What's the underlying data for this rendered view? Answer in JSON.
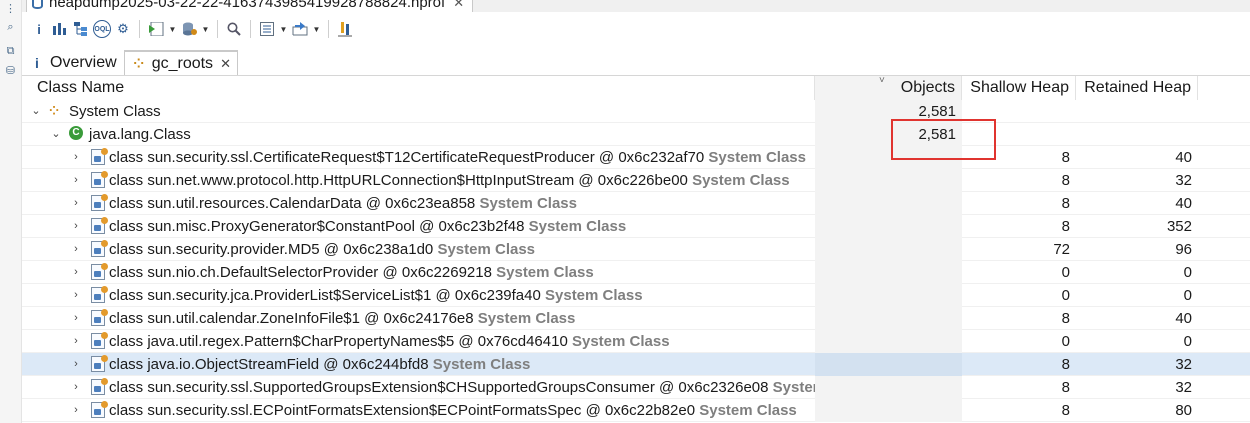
{
  "editor_tab": {
    "title": "heapdump2025-03-22-22-4163743985419928788824.hprof"
  },
  "toolbar": {
    "icons": [
      "info-icon",
      "histogram-icon",
      "dominator-tree-icon",
      "oql-icon",
      "thread-icon",
      "run-report-icon",
      "query-browser-icon",
      "search-icon",
      "group-by-icon",
      "export-icon",
      "pin-icon"
    ]
  },
  "view_tabs": [
    {
      "label": "Overview",
      "icon": "info-icon",
      "active": false
    },
    {
      "label": "gc_roots",
      "icon": "gc-roots-icon",
      "active": true
    }
  ],
  "table": {
    "headers": {
      "name": "Class Name",
      "objects": "Objects",
      "shallow": "Shallow Heap",
      "retained": "Retained Heap"
    },
    "system_class_tag": "System Class",
    "rows": [
      {
        "level": 0,
        "icon": "gc-roots-icon",
        "name": "System Class",
        "suffix": "",
        "objects": "2,581",
        "shallow": "",
        "retained": ""
      },
      {
        "level": 1,
        "icon": "class-type-icon",
        "name": "java.lang.Class",
        "suffix": "",
        "objects": "2,581",
        "shallow": "",
        "retained": ""
      },
      {
        "level": 2,
        "icon": "class-object-icon",
        "name": "class sun.security.ssl.CertificateRequest$T12CertificateRequestProducer @ 0x6c232af70",
        "suffix": "System Class",
        "objects": "",
        "shallow": "8",
        "retained": "40"
      },
      {
        "level": 2,
        "icon": "class-object-icon",
        "name": "class sun.net.www.protocol.http.HttpURLConnection$HttpInputStream @ 0x6c226be00",
        "suffix": "System Class",
        "objects": "",
        "shallow": "8",
        "retained": "32"
      },
      {
        "level": 2,
        "icon": "class-object-icon",
        "name": "class sun.util.resources.CalendarData @ 0x6c23ea858",
        "suffix": "System Class",
        "objects": "",
        "shallow": "8",
        "retained": "40"
      },
      {
        "level": 2,
        "icon": "class-object-icon",
        "name": "class sun.misc.ProxyGenerator$ConstantPool @ 0x6c23b2f48",
        "suffix": "System Class",
        "objects": "",
        "shallow": "8",
        "retained": "352"
      },
      {
        "level": 2,
        "icon": "class-object-icon",
        "name": "class sun.security.provider.MD5 @ 0x6c238a1d0",
        "suffix": "System Class",
        "objects": "",
        "shallow": "72",
        "retained": "96"
      },
      {
        "level": 2,
        "icon": "class-object-icon",
        "name": "class sun.nio.ch.DefaultSelectorProvider @ 0x6c2269218",
        "suffix": "System Class",
        "objects": "",
        "shallow": "0",
        "retained": "0"
      },
      {
        "level": 2,
        "icon": "class-object-icon",
        "name": "class sun.security.jca.ProviderList$ServiceList$1 @ 0x6c239fa40",
        "suffix": "System Class",
        "objects": "",
        "shallow": "0",
        "retained": "0"
      },
      {
        "level": 2,
        "icon": "class-object-icon",
        "name": "class sun.util.calendar.ZoneInfoFile$1 @ 0x6c24176e8",
        "suffix": "System Class",
        "objects": "",
        "shallow": "8",
        "retained": "40"
      },
      {
        "level": 2,
        "icon": "class-object-icon",
        "name": "class java.util.regex.Pattern$CharPropertyNames$5 @ 0x76cd46410",
        "suffix": "System Class",
        "objects": "",
        "shallow": "0",
        "retained": "0"
      },
      {
        "level": 2,
        "icon": "class-object-icon",
        "name": "class java.io.ObjectStreamField @ 0x6c244bfd8",
        "suffix": "System Class",
        "objects": "",
        "shallow": "8",
        "retained": "32",
        "selected": true
      },
      {
        "level": 2,
        "icon": "class-object-icon",
        "name": "class sun.security.ssl.SupportedGroupsExtension$CHSupportedGroupsConsumer @ 0x6c2326e08",
        "suffix": "System Class",
        "objects": "",
        "shallow": "8",
        "retained": "32"
      },
      {
        "level": 2,
        "icon": "class-object-icon",
        "name": "class sun.security.ssl.ECPointFormatsExtension$ECPointFormatsSpec @ 0x6c22b82e0",
        "suffix": "System Class",
        "objects": "",
        "shallow": "8",
        "retained": "80"
      }
    ]
  },
  "colors": {
    "highlight_box": "#e0342f",
    "selected_row": "#dce9f7",
    "system_class_text": "#7f7f7f"
  }
}
